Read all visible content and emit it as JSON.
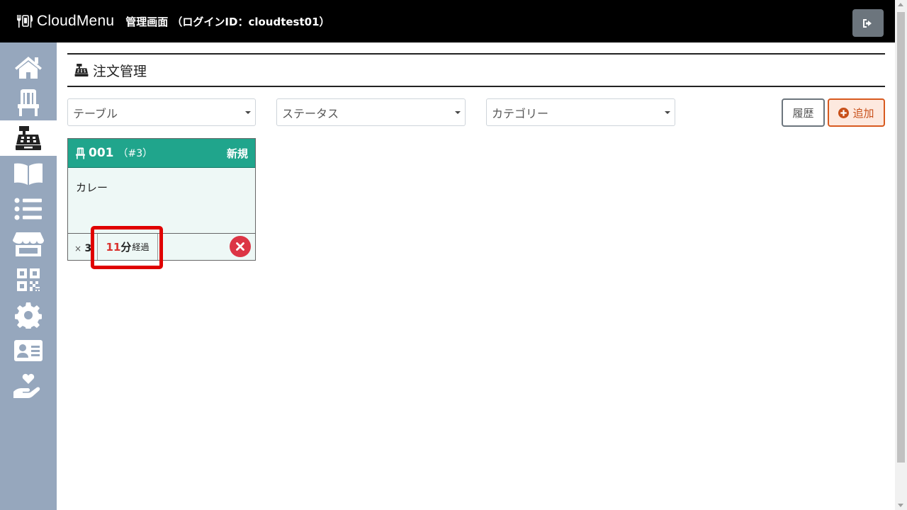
{
  "header": {
    "app_name": "CloudMenu",
    "admin_title": "管理画面 （ログインID：cloudtest01）"
  },
  "sidebar": {
    "items": [
      {
        "name": "home",
        "icon": "home-icon"
      },
      {
        "name": "tables",
        "icon": "chair-icon"
      },
      {
        "name": "orders",
        "icon": "cash-register-icon",
        "active": true
      },
      {
        "name": "menu",
        "icon": "book-open-icon"
      },
      {
        "name": "list",
        "icon": "list-icon"
      },
      {
        "name": "store",
        "icon": "store-icon"
      },
      {
        "name": "qr",
        "icon": "qrcode-icon"
      },
      {
        "name": "settings",
        "icon": "gear-icon"
      },
      {
        "name": "staff",
        "icon": "id-card-icon"
      },
      {
        "name": "support",
        "icon": "hand-holding-heart-icon"
      }
    ]
  },
  "page": {
    "title": "注文管理"
  },
  "filters": {
    "table_placeholder": "テーブル",
    "status_placeholder": "ステータス",
    "category_placeholder": "カテゴリー"
  },
  "buttons": {
    "history": "履歴",
    "add": "追加"
  },
  "order_card": {
    "table_no": "001",
    "seq": "（#3）",
    "status": "新規",
    "item_name": "カレー",
    "qty_prefix": "×",
    "qty": "3",
    "elapsed_minutes": "11",
    "elapsed_unit": "分",
    "elapsed_suffix": "経過"
  },
  "colors": {
    "header_bg": "#000000",
    "sidebar_bg": "#96a7bd",
    "card_header": "#20a58c",
    "accent_orange": "#d85a1f",
    "danger": "#dc3545",
    "highlight": "#e00000"
  }
}
